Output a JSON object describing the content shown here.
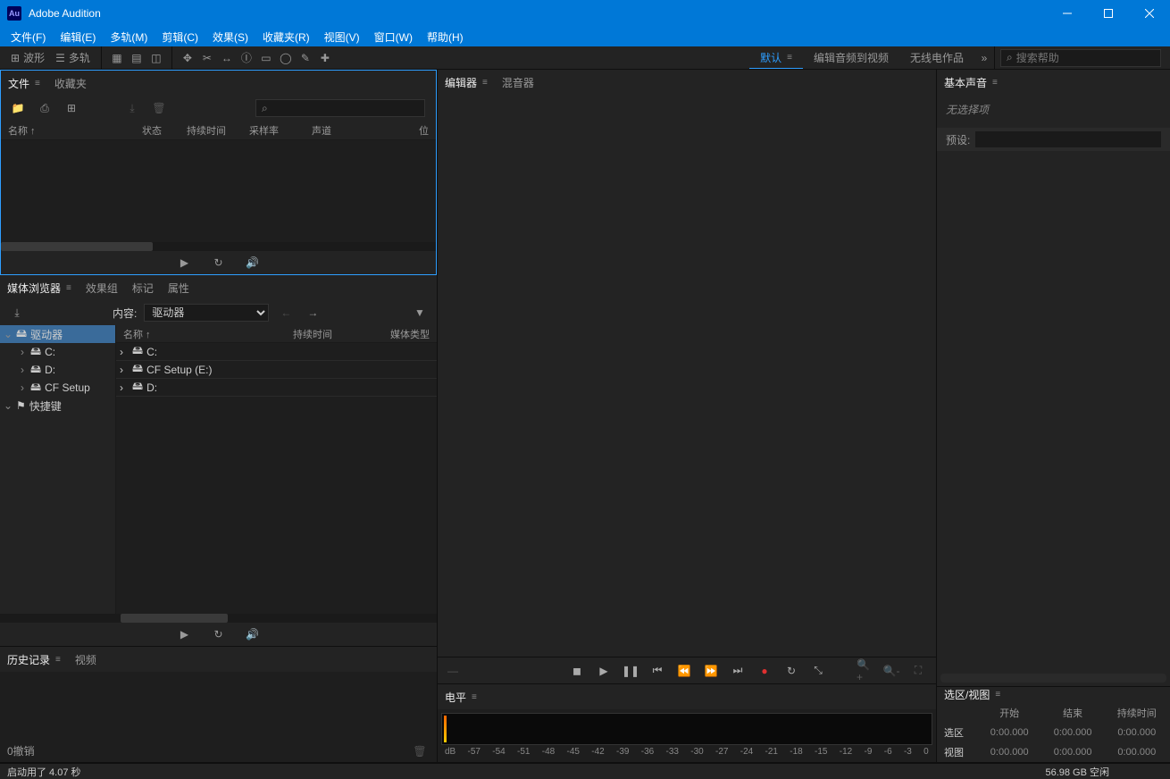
{
  "app": {
    "title": "Adobe Audition",
    "icon_text": "Au"
  },
  "menu": [
    "文件(F)",
    "编辑(E)",
    "多轨(M)",
    "剪辑(C)",
    "效果(S)",
    "收藏夹(R)",
    "视图(V)",
    "窗口(W)",
    "帮助(H)"
  ],
  "toolbar": {
    "waveform": "波形",
    "multitrack": "多轨"
  },
  "workspaces": {
    "default": "默认",
    "audio_video": "编辑音频到视频",
    "radio": "无线电作品"
  },
  "search": {
    "placeholder": "搜索帮助"
  },
  "panels": {
    "files": {
      "tabs": [
        "文件",
        "收藏夹"
      ],
      "headers": {
        "name": "名称 ↑",
        "status": "状态",
        "duration": "持续时间",
        "sample_rate": "采样率",
        "channels": "声道",
        "bit": "位"
      }
    },
    "media": {
      "tabs": [
        "媒体浏览器",
        "效果组",
        "标记",
        "属性"
      ],
      "content_label": "内容:",
      "content_value": "驱动器",
      "list_headers": {
        "name": "名称 ↑",
        "duration": "持续时间",
        "type": "媒体类型"
      },
      "tree": [
        {
          "label": "驱动器",
          "selected": true,
          "icon": "drive",
          "expanded": true,
          "children": [
            {
              "label": "C:",
              "icon": "disk"
            },
            {
              "label": "D:",
              "icon": "disk"
            },
            {
              "label": "CF Setup",
              "icon": "disk"
            }
          ]
        },
        {
          "label": "快捷键",
          "icon": "flag",
          "expanded": true
        }
      ],
      "list": [
        {
          "label": "C:"
        },
        {
          "label": "CF Setup (E:)"
        },
        {
          "label": "D:"
        }
      ]
    },
    "history": {
      "tabs": [
        "历史记录",
        "视频"
      ],
      "undo": "0撤销"
    },
    "editor": {
      "tabs": [
        "编辑器",
        "混音器"
      ]
    },
    "levels": {
      "title": "电平",
      "ticks": [
        "dB",
        "-57",
        "-54",
        "-51",
        "-48",
        "-45",
        "-42",
        "-39",
        "-36",
        "-33",
        "-30",
        "-27",
        "-24",
        "-21",
        "-18",
        "-15",
        "-12",
        "-9",
        "-6",
        "-3",
        "0"
      ]
    },
    "essential_sound": {
      "title": "基本声音",
      "no_selection": "无选择项",
      "preset_label": "预设:"
    },
    "selection": {
      "title": "选区/视图",
      "headers": {
        "start": "开始",
        "end": "结束",
        "duration": "持续时间"
      },
      "rows": [
        {
          "label": "选区",
          "start": "0:00.000",
          "end": "0:00.000",
          "dur": "0:00.000"
        },
        {
          "label": "视图",
          "start": "0:00.000",
          "end": "0:00.000",
          "dur": "0:00.000"
        }
      ]
    }
  },
  "status": {
    "startup": "启动用了 4.07 秒",
    "disk": "56.98 GB 空闲"
  }
}
